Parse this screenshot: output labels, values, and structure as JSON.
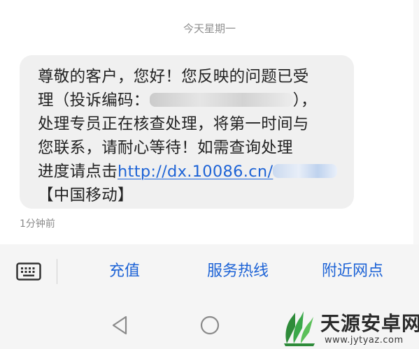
{
  "conversation": {
    "date_separator": "今天星期一",
    "message": {
      "line1": "尊敬的客户，您好！您反映的问题已受",
      "line2_before": "理（投诉编码：",
      "line2_after": "），",
      "line3": "处理专员正在核查处理，将第一时间与",
      "line4": "您联系，请耐心等待！如需查询处理",
      "line5_before": "进度请点击",
      "link_text": "http://dx.10086.cn/",
      "line6": "【中国移动】"
    },
    "timestamp": "1分钟前"
  },
  "bottom_menu": {
    "keyboard_icon": "keyboard-icon",
    "items": [
      {
        "label": "充值"
      },
      {
        "label": "服务热线"
      },
      {
        "label": "附近网点"
      }
    ]
  },
  "nav_bar": {
    "back_icon": "back-triangle-icon",
    "home_icon": "home-circle-icon"
  },
  "watermark": {
    "title": "天源安卓网",
    "url": "www.jytyaz.com"
  },
  "colors": {
    "link": "#1d63d6",
    "bubble": "#f0f0f0",
    "menu_text": "#1d63d6",
    "bottom_bar": "#f5f5f5"
  }
}
